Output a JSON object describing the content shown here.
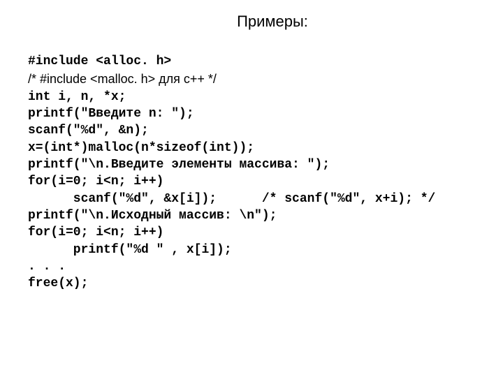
{
  "title": "Примеры:",
  "lines": [
    "#include <alloc. h>",
    "/* #include <malloc. h> для c++ */",
    "int i, n, *x;",
    "printf(\"Введите n: \");",
    "scanf(\"%d\", &n);",
    "x=(int*)malloc(n*sizeof(int));",
    "printf(\"\\n.Введите элементы массива: \");",
    "for(i=0; i<n; i++)",
    "      scanf(\"%d\", &x[i]);      /* scanf(\"%d\", x+i); */",
    "printf(\"\\n.Исходный массив: \\n\");",
    "for(i=0; i<n; i++)",
    "      printf(\"%d \" , x[i]);",
    ". . .",
    "free(x);"
  ]
}
